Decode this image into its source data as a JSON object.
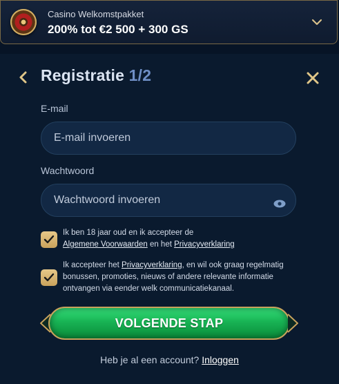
{
  "promo": {
    "subtitle": "Casino Welkomstpakket",
    "title": "200% tot €2 500 + 300 GS"
  },
  "modal": {
    "title": "Registratie ",
    "step": "1/2",
    "email": {
      "label": "E-mail",
      "placeholder": "E-mail invoeren"
    },
    "password": {
      "label": "Wachtwoord",
      "placeholder": "Wachtwoord invoeren"
    },
    "consent_age": {
      "text_1": "Ik ben 18 jaar oud en ik accepteer de",
      "link_terms": "Algemene Voorwaarden",
      "text_2": " en het ",
      "link_privacy": "Privacyverklaring"
    },
    "consent_marketing": {
      "text_1": "Ik accepteer het ",
      "link_privacy": "Privacyverklaring",
      "text_2": ", en wil ook graag regelmatig bonussen, promoties, nieuws of andere relevante informatie ontvangen via eender welk communicatiekanaal."
    },
    "next_button": "VOLGENDE STAP",
    "login_prompt": "Heb je al een account? ",
    "login_link": "Inloggen"
  },
  "colors": {
    "background": "#0a1a2e",
    "accent_gold": "#c9a35c",
    "button_green": "#18b354",
    "input_bg": "#122844"
  },
  "icons": [
    "roulette-wheel-icon",
    "chevron-down-icon",
    "back-arrow-icon",
    "close-icon",
    "eye-icon",
    "checkmark-icon"
  ]
}
